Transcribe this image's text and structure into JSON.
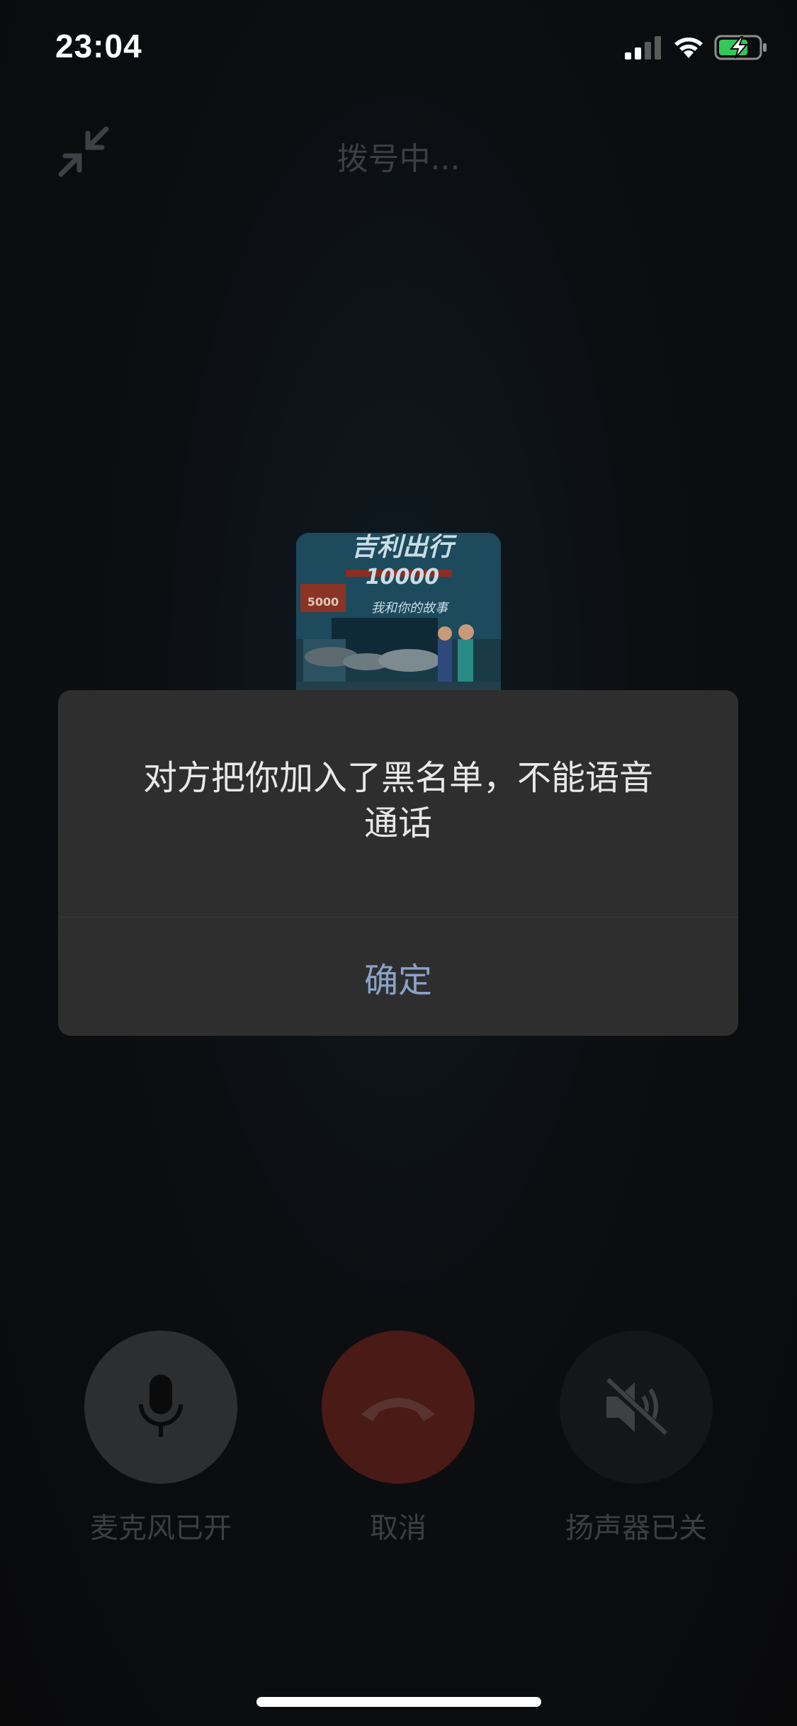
{
  "status_bar": {
    "time": "23:04"
  },
  "call": {
    "status": "拨号中..."
  },
  "avatar": {
    "brand_text": "吉利出行",
    "number_text": "10000",
    "slogan_text": "我和你的故事",
    "badge_text": "5000"
  },
  "controls": {
    "mic_label": "麦克风已开",
    "cancel_label": "取消",
    "speaker_label": "扬声器已关"
  },
  "dialog": {
    "message_line1": "对方把你加入了黑名单，不能语音",
    "message_line2": "通话",
    "confirm_label": "确定"
  },
  "colors": {
    "accent_link": "#8aa3c8",
    "cancel_red": "#4a1a17",
    "battery_green": "#34c759"
  },
  "icons": [
    "signal-icon",
    "wifi-icon",
    "battery-charging-icon",
    "minimize-icon",
    "microphone-icon",
    "hang-up-icon",
    "speaker-muted-icon"
  ]
}
